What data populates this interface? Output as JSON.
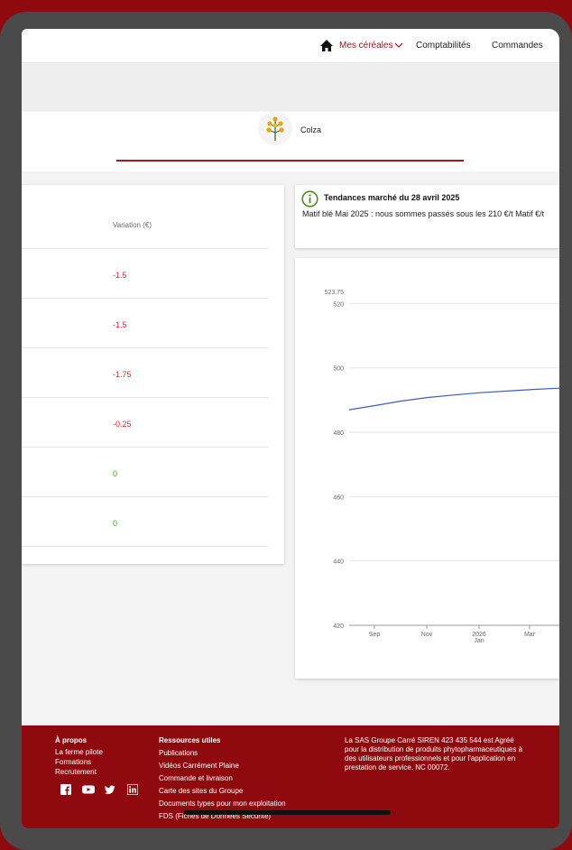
{
  "nav": {
    "home_icon": "home-icon",
    "cereales_label": "Mes céréales",
    "comptabilites_label": "Comptabilités",
    "commandes_label": "Commandes"
  },
  "crop": {
    "name": "Colza",
    "icon": "rapeseed-flower-icon"
  },
  "table": {
    "header": "Variation (€)",
    "rows": [
      {
        "value": "-1.5",
        "status": "negative"
      },
      {
        "value": "-1.5",
        "status": "negative"
      },
      {
        "value": "-1.75",
        "status": "negative"
      },
      {
        "value": "-0.25",
        "status": "negative"
      },
      {
        "value": "0",
        "status": "neutral"
      },
      {
        "value": "0",
        "status": "neutral"
      }
    ]
  },
  "trend": {
    "title": "Tendances marché du 28 avril 2025",
    "text": "Matif blé Mai 2025 : nous sommes passés sous les 210 €/t Matif €/t",
    "icon": "info-icon"
  },
  "chart_data": {
    "type": "line",
    "y_ticks": [
      "523.75",
      "520",
      "500",
      "480",
      "460",
      "440",
      "420"
    ],
    "x_ticks": [
      "Sep",
      "Nov",
      "2026",
      "Mar"
    ],
    "x_subticks": [
      "",
      "",
      "Jan",
      ""
    ],
    "ylim": [
      420,
      523.75
    ],
    "series": [
      {
        "x": [
          "Aug 2025",
          "Sep 2025",
          "Oct 2025",
          "Nov 2025",
          "Dec 2025",
          "Jan 2026",
          "Feb 2026",
          "Mar 2026",
          "Apr 2026"
        ],
        "values": [
          487,
          488.3,
          489.7,
          490.8,
          491.6,
          492.3,
          492.8,
          493.3,
          493.7
        ]
      }
    ],
    "line_color": "#3a5fbf"
  },
  "footer": {
    "apropos_title": "À propos",
    "apropos_links": [
      "La ferme pilote",
      "Formations",
      "Recrutement"
    ],
    "ressources_title": "Ressources utiles",
    "ressources_links": [
      "Publications",
      "Vidéos Carrément Plaine",
      "Commande et livraison",
      "Carte des sites du Groupe",
      "Documents types pour mon exploitation",
      "FDS (Fiches de Données Sécurité)"
    ],
    "legal": "La SAS Groupe Carré SIREN 423 435 544 est Agréé pour la distribution de produits phytopharmaceutiques à des utilisateurs professionnels et pour l'application en prestation de service. NC 00072.",
    "social_icons": [
      "facebook-icon",
      "youtube-icon",
      "twitter-icon",
      "linkedin-icon"
    ]
  },
  "colors": {
    "brand": "#8f0a0e",
    "negative": "#e0242e",
    "positive": "#38a61c",
    "accent": "#a0111b"
  }
}
